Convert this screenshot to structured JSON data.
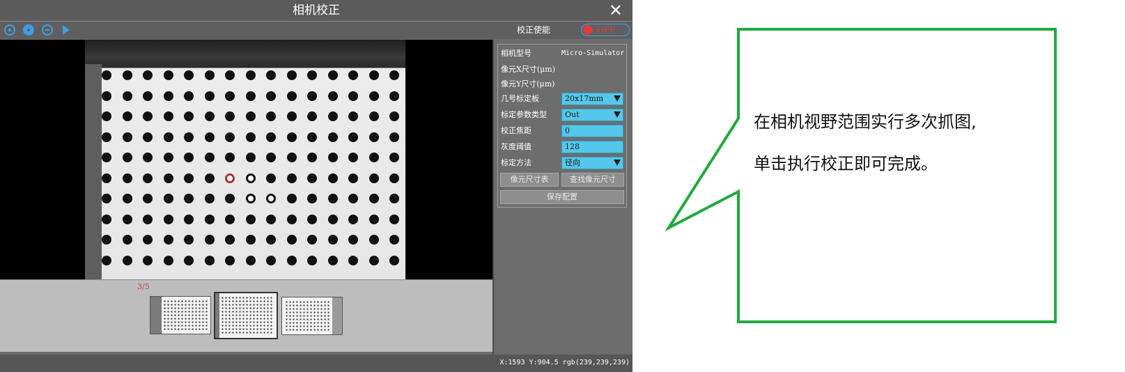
{
  "window": {
    "title": "相机校正",
    "close_icon": "close-icon"
  },
  "toolbar": {
    "icons": [
      "circle-play-icon",
      "aperture-icon",
      "minus-circle-icon",
      "play-icon"
    ],
    "calibration_enable_label": "校正使能",
    "toggle_label": "OFF",
    "accent_color": "#3d9ee6",
    "toggle_color": "#e23a3a"
  },
  "viewer": {
    "image_counter": "3/5"
  },
  "params": {
    "camera_model_label": "相机型号",
    "camera_model_value": "Micro-Simulator",
    "pixel_x_label": "像元X尺寸(μm)",
    "pixel_y_label": "像元Y尺寸(μm)",
    "board_label": "几号标定板",
    "board_value": "20x17mm",
    "param_type_label": "标定参数类型",
    "param_type_value": "Out",
    "focal_label": "校正焦距",
    "focal_value": "0",
    "gray_label": "灰度阈值",
    "gray_value": "128",
    "method_label": "标定方法",
    "method_value": "径向",
    "field_color": "#54c7ea"
  },
  "buttons": {
    "pixel_table": "像元尺寸表",
    "find_pixel": "查找像元尺寸",
    "save_config": "保存配置"
  },
  "status": {
    "readout": "X:1593 Y:904.5 rgb(239,239,239)"
  },
  "callout": {
    "line1": "在相机视野范围实行多次抓图,",
    "line2": "单击执行校正即可完成。",
    "border_color": "#1faa3c"
  }
}
